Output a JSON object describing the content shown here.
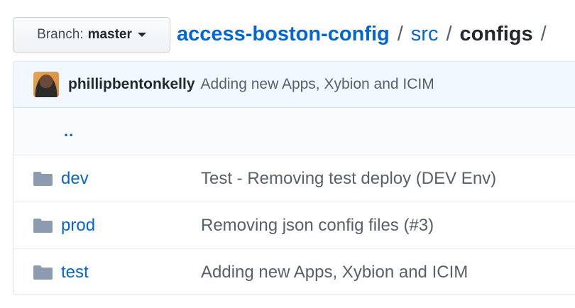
{
  "branch": {
    "label": "Branch:",
    "value": "master"
  },
  "breadcrumb": {
    "root": "access-boston-config",
    "parts": [
      "src"
    ],
    "current": "configs",
    "separator": "/"
  },
  "commit": {
    "author": "phillipbentonkelly",
    "message": "Adding new Apps, Xybion and ICIM"
  },
  "parent_link": "..",
  "entries": [
    {
      "name": "dev",
      "icon": "folder-icon",
      "message": "Test - Removing test deploy (DEV Env)"
    },
    {
      "name": "prod",
      "icon": "folder-icon",
      "message": "Removing json config files (#3)"
    },
    {
      "name": "test",
      "icon": "folder-icon",
      "message": "Adding new Apps, Xybion and ICIM"
    }
  ],
  "colors": {
    "link": "#0366d6",
    "folder": "#79b8ff",
    "commit_bar": "#f1f8ff"
  }
}
